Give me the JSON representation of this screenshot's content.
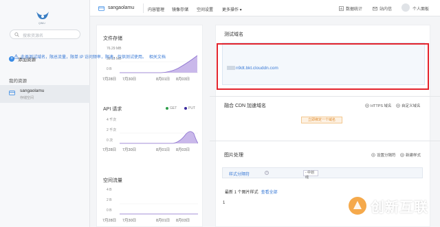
{
  "sidebar": {
    "search_placeholder": "搜索资源名",
    "add_resource": "添加资源",
    "my_resources": "我的资源",
    "bucket": {
      "name": "sangaolamu",
      "type": "存储空间"
    }
  },
  "topbar": {
    "bucket_name": "sangaolamu",
    "nav": [
      "内容管理",
      "镜像存储",
      "空间设置",
      "更多操作"
    ],
    "data_stats": "数据统计",
    "inbox": "站内信",
    "user": "个人面板"
  },
  "stats": {
    "storage": {
      "title": "文件存储",
      "y_labels": [
        "76.29 MB",
        "38.15 MB",
        "0 B"
      ],
      "x_labels": [
        "7月28日",
        "7月30日",
        "8月01日",
        "8月03日"
      ]
    },
    "api": {
      "title": "API 请求",
      "legend": [
        {
          "name": "GET",
          "color": "#2e9e4a"
        },
        {
          "name": "PUT",
          "color": "#3a2a9e"
        }
      ],
      "y_labels": [
        "4 千次",
        "2 千次",
        "0 次"
      ],
      "x_labels": [
        "7月28日",
        "7月30日",
        "8月01日",
        "8月03日"
      ]
    },
    "traffic": {
      "title": "空间流量",
      "y_labels": [
        "4 B",
        "2 B",
        "0 B"
      ],
      "x_labels": [
        "7月28日",
        "7月30日",
        "8月01日",
        "8月03日"
      ]
    }
  },
  "main": {
    "test_domain": {
      "title": "测试域名",
      "notice": "此类测试域名，限总流量，限单 IP 访问频率，限速，仅供测试使用。",
      "doc_link": "相关文档",
      "domain": "n9dt.bkt.clouddn.com"
    },
    "cdn": {
      "title": "融合 CDN 加速域名",
      "https_link": "HTTPS 域名",
      "custom_link": "自定义域名",
      "bind_button": "立即绑定一个域名"
    },
    "image": {
      "title": "图片处理",
      "separator_link": "设置分隔符",
      "new_style_link": "新建样式",
      "style_sep_label": "样式分隔符",
      "style_sep_value": "- 中划线",
      "recent_text": "最新 1 个图片样式",
      "view_all": "查看全部",
      "count": "1"
    }
  },
  "watermark": {
    "text": "创新互联"
  },
  "colors": {
    "accent": "#3a8be5",
    "chart_fill": "#c9b8ea",
    "chart_line": "#8a6fcf",
    "highlight": "#e3222b"
  }
}
